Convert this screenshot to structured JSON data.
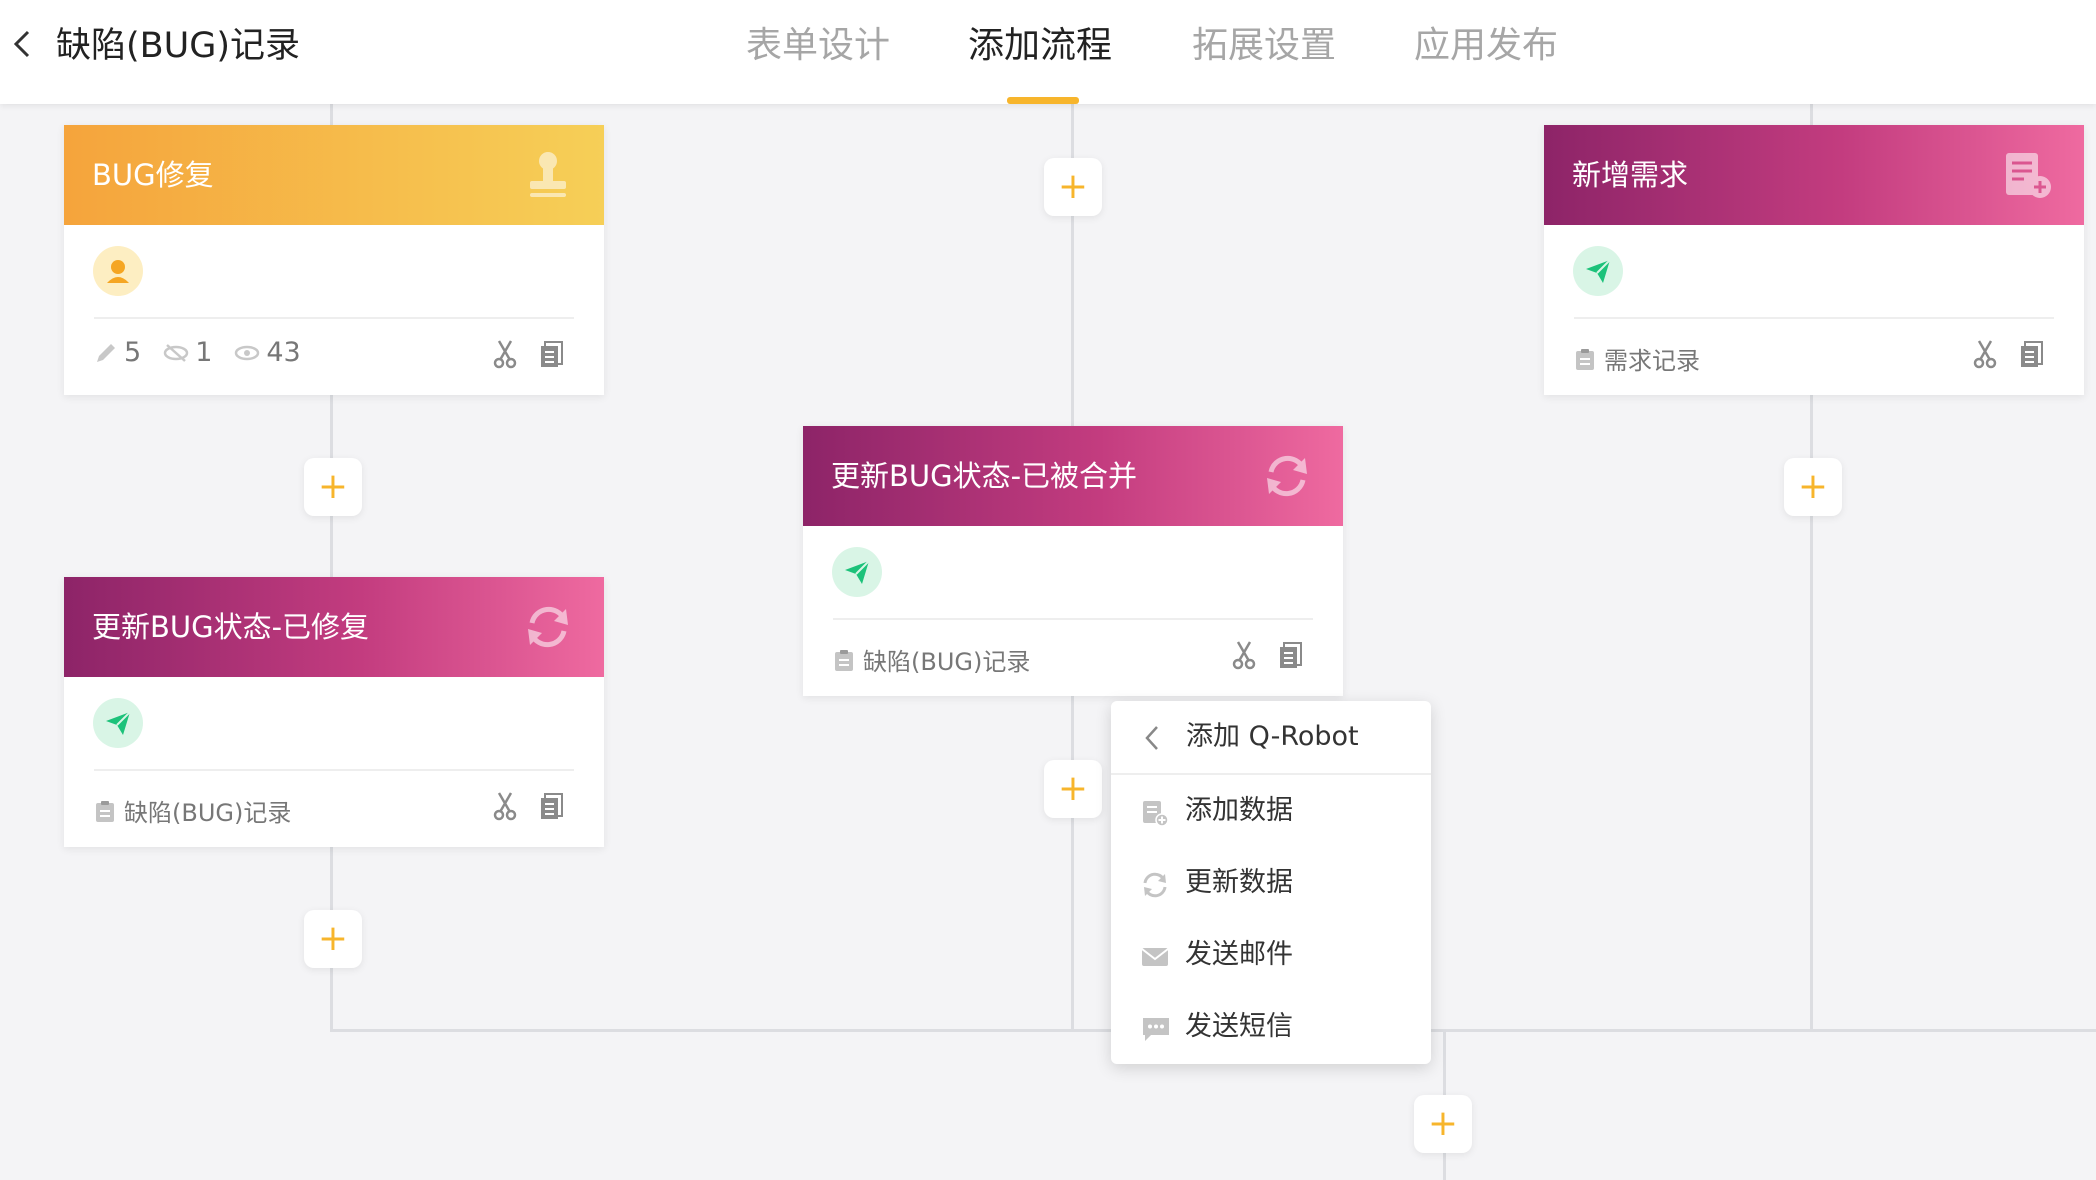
{
  "header": {
    "title": "缺陷(BUG)记录",
    "tabs": [
      {
        "label": "表单设计"
      },
      {
        "label": "添加流程"
      },
      {
        "label": "拓展设置"
      },
      {
        "label": "应用发布"
      }
    ],
    "active_tab": "添加流程"
  },
  "colors": {
    "accent": "#f7b52c",
    "orange_start": "#f5a43c",
    "orange_end": "#f6cf57",
    "purple_start": "#8d2468",
    "purple_end": "#ef6aa0",
    "send_green": "#1cc27a"
  },
  "cards": {
    "bug_fix": {
      "title": "BUG修复",
      "icon": "stamp-icon",
      "stats": {
        "edit": "5",
        "hidden": "1",
        "view": "43"
      }
    },
    "update_fixed": {
      "title": "更新BUG状态-已修复",
      "icon": "refresh-icon",
      "form": "缺陷(BUG)记录"
    },
    "update_merged": {
      "title": "更新BUG状态-已被合并",
      "icon": "refresh-icon",
      "form": "缺陷(BUG)记录"
    },
    "new_requirement": {
      "title": "新增需求",
      "icon": "add-record-icon",
      "form": "需求记录"
    }
  },
  "menu": {
    "header": "添加 Q-Robot",
    "items": [
      {
        "label": "添加数据",
        "icon": "add-data-icon"
      },
      {
        "label": "更新数据",
        "icon": "refresh-icon"
      },
      {
        "label": "发送邮件",
        "icon": "mail-icon"
      },
      {
        "label": "发送短信",
        "icon": "sms-icon"
      }
    ]
  }
}
